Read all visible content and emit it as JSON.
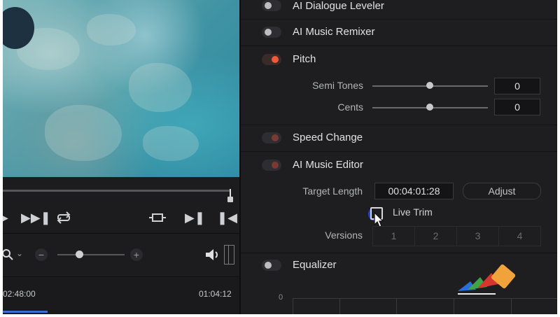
{
  "viewer": {
    "timeline": {
      "start_timecode": "02:48:00",
      "end_timecode": "01:04:12"
    }
  },
  "transport": {
    "icons": [
      "skip-forward-icon",
      "loop-icon",
      "trim-icon",
      "next-frame-icon",
      "previous-frame-icon"
    ],
    "zoom": {
      "minus": "−",
      "plus": "+"
    }
  },
  "panel": {
    "sections": {
      "ai_dialogue_leveler": {
        "label": "AI Dialogue Leveler",
        "enabled": false
      },
      "ai_music_remixer": {
        "label": "AI Music Remixer",
        "enabled": false
      },
      "pitch": {
        "label": "Pitch",
        "enabled": true,
        "semi_tones": {
          "label": "Semi Tones",
          "value": "0",
          "level": 0.5
        },
        "cents": {
          "label": "Cents",
          "value": "0",
          "level": 0.5
        }
      },
      "speed_change": {
        "label": "Speed Change",
        "enabled": true
      },
      "ai_music_editor": {
        "label": "AI Music Editor",
        "enabled": true,
        "target_length_label": "Target Length",
        "target_length_value": "00:04:01:28",
        "adjust_label": "Adjust",
        "live_trim_label": "Live Trim",
        "versions_label": "Versions",
        "versions": [
          "1",
          "2",
          "3",
          "4"
        ]
      },
      "equalizer": {
        "label": "Equalizer",
        "enabled": false,
        "axis_value": "0"
      }
    }
  },
  "colors": {
    "accent": "#ef5a3a",
    "panel_bg": "#1e1e21",
    "text": "#e2e2e5"
  }
}
